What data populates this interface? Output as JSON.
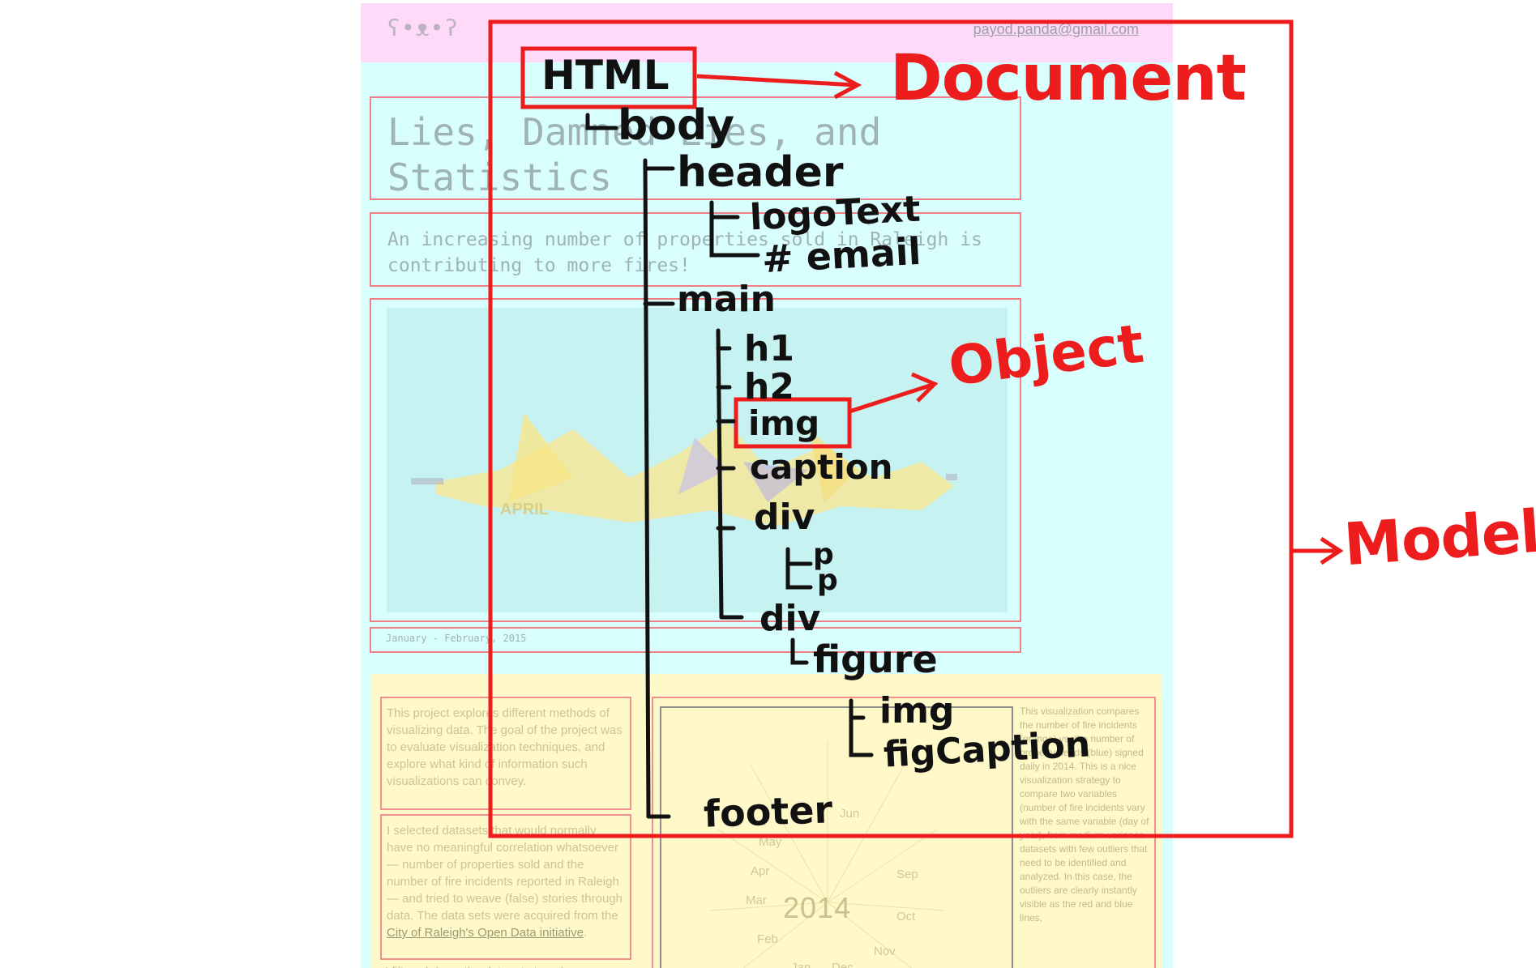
{
  "page": {
    "logo_text": "ʕ•ᴥ•ʔ",
    "email": "payod.panda@gmail.com",
    "title": "Lies, Damned Lies, and Statistics",
    "subtitle": "An increasing number of properties sold in Raleigh is contributing to more fires!",
    "image_caption": "January - February, 2015",
    "intro_paragraph": "This project explores different methods of visualizing data. The goal of the project was to evaluate visualization techniques, and explore what kind of information such visualizations can convey.",
    "datasets_paragraph": "I selected datasets that would normally have no meaningful correlation whatsoever — number of properties sold and the number of fire incidents reported in Raleigh — and tried to weave (false) stories through data. The data sets were acquired from the",
    "datasets_link": "City of Raleigh's Open Data initiative",
    "filtered_paragraph": "I filtered down the datasets to only",
    "figure_year": "2014",
    "figure_months": [
      "Apr",
      "Mar",
      "Feb",
      "Jan",
      "Dec",
      "Nov",
      "Oct",
      "Sep",
      "May",
      "Jun"
    ],
    "figure_caption": "This visualization compares the number of fire incidents (orange) vs. the number of property deeds (blue) signed daily in 2014. This is a nice visualization strategy to compare two variables (number of fire incidents vary with the same variable (day of year), from medium-variance datasets with few outliers that need to be identified and analyzed. In this case, the outliers are clearly instantly visible as the red and blue lines,"
  },
  "annotation": {
    "html_label": "HTML",
    "document_label": "Document",
    "object_label": "Object",
    "model_label": "Model",
    "tree": {
      "body": "body",
      "header": "header",
      "logoText": "logoText",
      "email": "# email",
      "main": "main",
      "h1": "h1",
      "h2": "h2",
      "img": "img",
      "caption": "caption",
      "div1": "div",
      "p1": "p",
      "p2": "p",
      "div2": "div",
      "figure": "figure",
      "figure_img": "img",
      "figCaption": "figCaption",
      "footer": "footer"
    }
  },
  "colors": {
    "annotation_red": "#ee1d1d",
    "header_pink": "#ffd9f8",
    "page_cyan": "#d8fefe",
    "section_yellow": "#fff8c8"
  }
}
